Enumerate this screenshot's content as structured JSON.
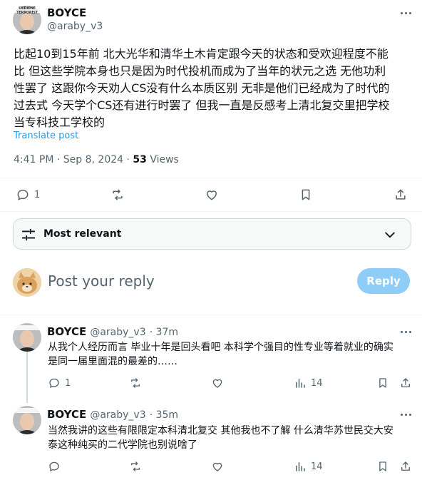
{
  "main_post": {
    "author_name": "BOYCE",
    "author_handle": "@araby_v3",
    "avatar_badge": "UKRAINE TERRORIST",
    "text_lines": [
      "比起10到15年前 北大光华和清华土木肯定跟今天的状态和受欢迎程度不能",
      "比 但这些学院本身也只是因为时代投机而成为了当年的状元之选 无他功利",
      "性罢了 这跟你今天劝人CS没有什么本质区别 无非是他们已经成为了时代的",
      "过去式 今天学个CS还有进行时罢了 但我一直是反感考上清北复交里把学校",
      "当专科技工学校的"
    ],
    "translate_label": "Translate post",
    "timestamp": "4:41 PM · Sep 8, 2024 · ",
    "views_count": "53",
    "views_label": " Views",
    "reply_count": "1"
  },
  "sort": {
    "label": "Most relevant"
  },
  "composer": {
    "placeholder": "Post your reply",
    "button_label": "Reply"
  },
  "replies": [
    {
      "author_name": "BOYCE",
      "author_handle": "@araby_v3",
      "time": "· 37m",
      "text_lines": [
        "从我个人经历而言 毕业十年是回头看吧 本科学个强目的性专业等着就业的确实",
        "是同一届里面混的最差的……"
      ],
      "reply_count": "1",
      "views_count": "14"
    },
    {
      "author_name": "BOYCE",
      "author_handle": "@araby_v3",
      "time": "· 35m",
      "text_lines": [
        "当然我讲的这些有限限定本科清北复交 其他我也不了解 什么清华苏世民交大安",
        "泰这种纯买的二代学院也别说啥了"
      ],
      "reply_count": "",
      "views_count": "14"
    }
  ]
}
